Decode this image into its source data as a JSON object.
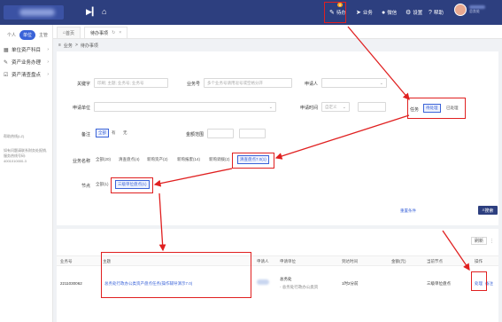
{
  "topbar": {
    "menus": [
      {
        "label": "待办",
        "icon": "task-icon",
        "badge": "8"
      },
      {
        "label": "业务",
        "icon": "send-icon"
      },
      {
        "label": "微信",
        "icon": "chat-icon"
      },
      {
        "label": "设置",
        "icon": "gear-icon"
      },
      {
        "label": "帮助",
        "icon": "help-icon"
      }
    ],
    "user_sub": "总务处"
  },
  "sidebar": {
    "tabs": [
      "个人",
      "单位",
      "主管"
    ],
    "items": [
      "单位资产科目",
      "资产业务办理",
      "资产清查盘点"
    ],
    "note1": "帮助热线(LZ)",
    "note2": "如有问题请联系财务处报销, 服务热线号码:",
    "note3": "4001010000-3"
  },
  "tabs": [
    {
      "label": "首页"
    },
    {
      "label": "待办事项",
      "close": "×"
    }
  ],
  "breadcrumb": [
    "业务",
    ">",
    "待办事项"
  ],
  "filters": {
    "keyword_label": "关键字",
    "keyword_placeholder": "印刷; 主题; 业务号; 业务号",
    "bizno_label": "业务号",
    "bizno_placeholder": "多个业务号请用逗号或空格分开",
    "applicant_label": "申请人",
    "applicant_placeholder": "",
    "unit_label": "申请单位",
    "apptime_label": "申请时间",
    "apptime_placeholder": "自定义",
    "task_label": "任务",
    "task_options": [
      "待处理",
      "已处理"
    ],
    "remark_label": "备注",
    "remark_options": [
      "全部",
      "有",
      "无"
    ],
    "amount_label": "金额范围",
    "bizname_label": "业务名称",
    "bizname_options": [
      "全部(20)",
      "清查盘点(4)",
      "新购资产(2)",
      "新购报废(14)",
      "新购调拨(2)",
      "清查盘点7.0(1)"
    ],
    "node_label": "节点",
    "node_options": [
      "全部(1)",
      "三级单位盘点(1)"
    ],
    "reset_label": "重置条件",
    "search_label": "搜索"
  },
  "table": {
    "toolbar": {
      "refresh": "刷新",
      "more": "⋮"
    },
    "headers": [
      "业务号",
      "主题",
      "申请人",
      "申请单位",
      "到达时间",
      "金额(元)",
      "当前节点",
      "操作"
    ],
    "rows": [
      {
        "bizno": "2211030062",
        "subject": "总务处行政办公类资产盘点任务(操作辅导演示7.0)",
        "applicant": "",
        "unit_line1": "总务处",
        "unit_line2": "- 总务处行政办公类资",
        "arrival": "1时2分前",
        "amount": "",
        "node": "三级单位盘点",
        "ops": [
          "处理",
          "备注"
        ]
      }
    ]
  }
}
